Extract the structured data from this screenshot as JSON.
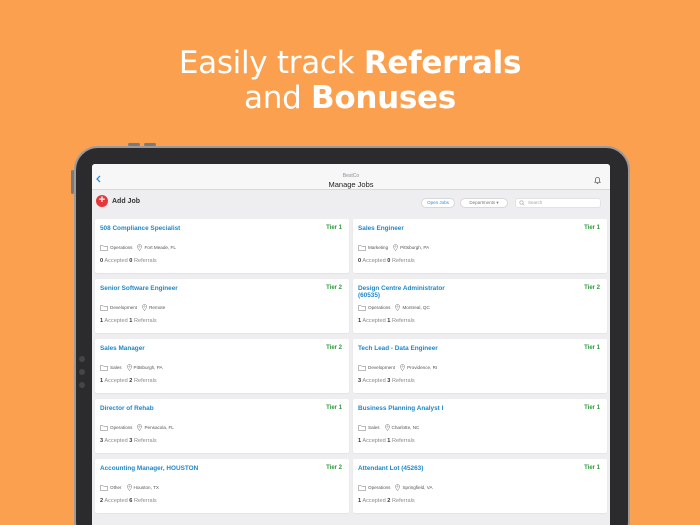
{
  "headline": {
    "line1_pre": "Easily track ",
    "line1_bold": "Referrals",
    "line2_pre": "and ",
    "line2_bold": "Bonuses"
  },
  "colors": {
    "background": "#FBA04E",
    "accent": "#1E87C9",
    "tier": "#2E9B3C",
    "add": "#E8373A"
  },
  "nav": {
    "subtitle": "BestCo",
    "title": "Manage Jobs",
    "back_icon": "chevron-left-icon",
    "bell_icon": "bell-icon"
  },
  "toolbar": {
    "add_label": "Add Job",
    "open_jobs_label": "Open Jobs",
    "departments_label": "Departments",
    "search_placeholder": "Search"
  },
  "jobs": [
    {
      "title": "508 Compliance Specialist",
      "tier": "Tier 1",
      "department": "Operations",
      "location": "Fort Meade, FL",
      "accepted": "0",
      "accepted_label": "Accepted",
      "referrals": "0",
      "referrals_label": "Referrals"
    },
    {
      "title": "Sales Engineer",
      "tier": "Tier 1",
      "department": "Marketing",
      "location": "Pittsburgh, PA",
      "accepted": "0",
      "accepted_label": "Accepted",
      "referrals": "0",
      "referrals_label": "Referrals"
    },
    {
      "title": "Senior Software Engineer",
      "tier": "Tier 2",
      "department": "Development",
      "location": "Remote",
      "accepted": "1",
      "accepted_label": "Accepted",
      "referrals": "1",
      "referrals_label": "Referrals"
    },
    {
      "title": "Design Centre Administrator (60535)",
      "tier": "Tier 2",
      "department": "Operations",
      "location": "Montreal, QC",
      "accepted": "1",
      "accepted_label": "Accepted",
      "referrals": "1",
      "referrals_label": "Referrals"
    },
    {
      "title": "Sales Manager",
      "tier": "Tier 2",
      "department": "Sales",
      "location": "Pittsburgh, PA",
      "accepted": "1",
      "accepted_label": "Accepted",
      "referrals": "2",
      "referrals_label": "Referrals"
    },
    {
      "title": "Tech Lead - Data Engineer",
      "tier": "Tier 1",
      "department": "Development",
      "location": "Providence, RI",
      "accepted": "3",
      "accepted_label": "Accepted",
      "referrals": "3",
      "referrals_label": "Referrals"
    },
    {
      "title": "Director of Rehab",
      "tier": "Tier 1",
      "department": "Operations",
      "location": "Pensacola, FL",
      "accepted": "3",
      "accepted_label": "Accepted",
      "referrals": "3",
      "referrals_label": "Referrals"
    },
    {
      "title": "Business Planning Analyst I",
      "tier": "Tier 1",
      "department": "Sales",
      "location": "Charlotte, NC",
      "accepted": "1",
      "accepted_label": "Accepted",
      "referrals": "1",
      "referrals_label": "Referrals"
    },
    {
      "title": "Accounting Manager, HOUSTON",
      "tier": "Tier 2",
      "department": "Other",
      "location": "Houston, TX",
      "accepted": "2",
      "accepted_label": "Accepted",
      "referrals": "6",
      "referrals_label": "Referrals"
    },
    {
      "title": "Attendant Lot (45263)",
      "tier": "Tier 1",
      "department": "Operations",
      "location": "Springfield, VA",
      "accepted": "1",
      "accepted_label": "Accepted",
      "referrals": "2",
      "referrals_label": "Referrals"
    }
  ]
}
